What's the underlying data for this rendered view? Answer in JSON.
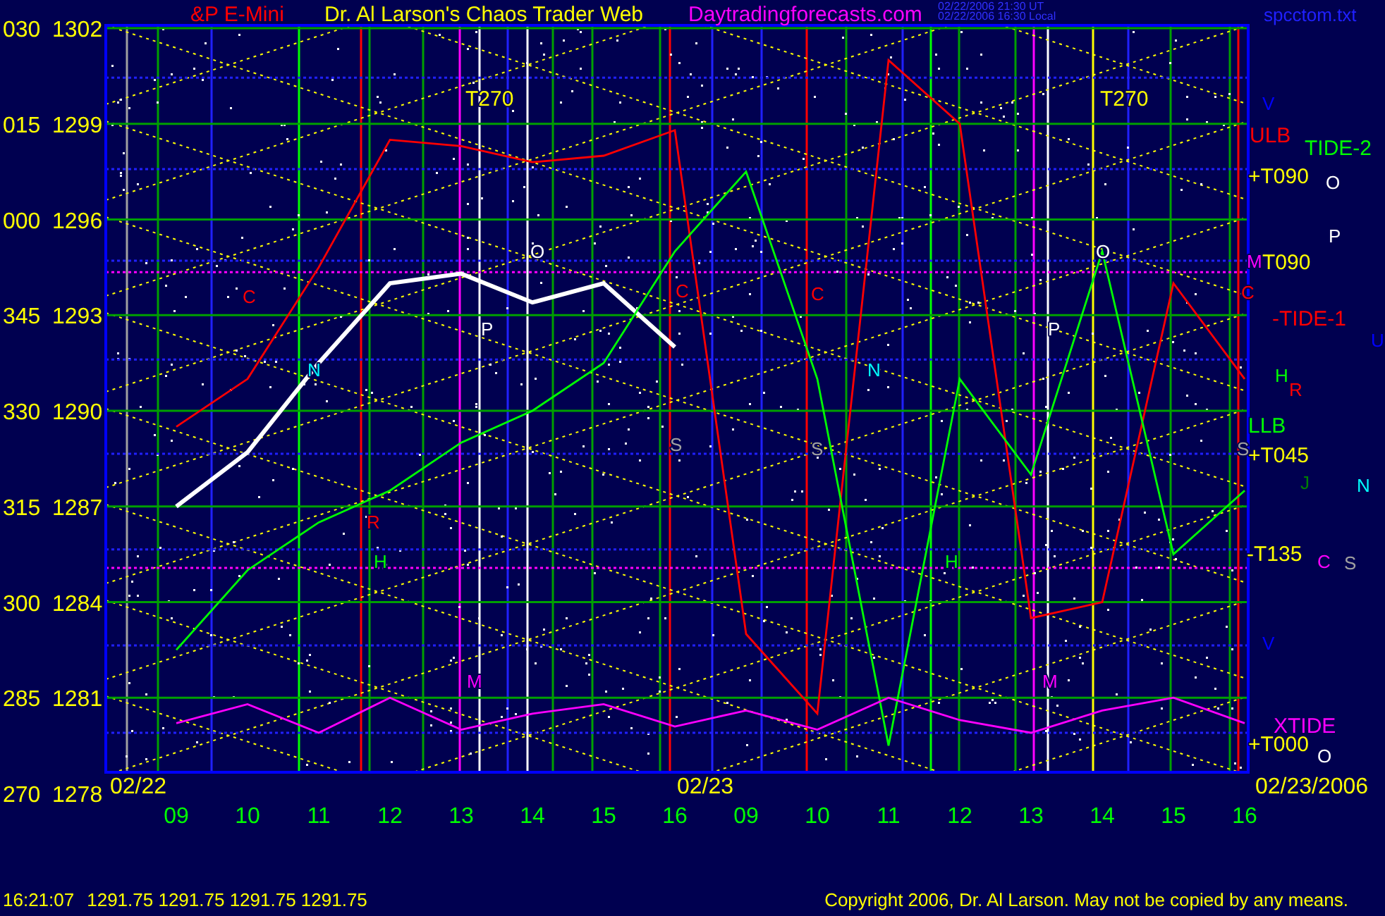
{
  "header": {
    "site_title": "Dr. Al Larson's Chaos Trader Web",
    "website": "Daytradingforecasts.com",
    "timestamps": [
      "02/22/2006 21:30 UT",
      "02/22/2006 16:30 Local"
    ],
    "file_name": "spcctom.txt"
  },
  "chart": {
    "angle_labels": [
      "030",
      "015",
      "000",
      "345",
      "330",
      "315",
      "300",
      "285",
      "270"
    ],
    "chart_data": {
      "type": "line",
      "title": "&P E-Mini",
      "categories": [
        "09",
        "10",
        "11",
        "12",
        "13",
        "14",
        "15",
        "16",
        "09",
        "10",
        "11",
        "12",
        "13",
        "14",
        "15",
        "16"
      ],
      "series": [
        {
          "color": "#ffffff",
          "values": [
            1287,
            1288.7,
            1291.5,
            1294,
            1294.3,
            1293.4,
            1294,
            1292,
            null,
            null,
            null,
            null,
            null,
            null,
            null,
            null
          ]
        },
        {
          "color": "#ff0000",
          "values": [
            1289.5,
            1291,
            1294.5,
            1298.5,
            1298.3,
            1297.8,
            1298,
            1298.8,
            1283,
            1280.5,
            1301,
            1299,
            1283.5,
            1284,
            1294,
            1291
          ]
        },
        {
          "color": "#00ff00",
          "values": [
            1282.5,
            1285,
            1286.5,
            1287.5,
            1289,
            1290,
            1291.5,
            1295,
            1297.5,
            1291,
            1279.5,
            1291,
            1288,
            1295,
            1285.5,
            1287.5
          ]
        },
        {
          "color": "#ff00ff",
          "values": [
            1280.2,
            1280.8,
            1279.9,
            1281,
            1280,
            1280.5,
            1280.8,
            1280.1,
            1280.6,
            1280,
            1281,
            1280.3,
            1279.9,
            1280.6,
            1281,
            1280.2
          ]
        }
      ],
      "ylim": [
        1278,
        1302.09
      ],
      "grid": true,
      "ref_lines": [
        {
          "axis": "y",
          "value": 1300.45,
          "color": "#2020ff"
        },
        {
          "axis": "y",
          "value": 1297.58,
          "color": "#2020ff"
        },
        {
          "axis": "y",
          "value": 1294.71,
          "color": "#2020ff"
        },
        {
          "axis": "y",
          "value": 1291.61,
          "color": "#2020ff"
        },
        {
          "axis": "y",
          "value": 1288.65,
          "color": "#2020ff"
        },
        {
          "axis": "y",
          "value": 1285.65,
          "color": "#2020ff"
        },
        {
          "axis": "y",
          "value": 1282.64,
          "color": "#2020ff"
        },
        {
          "axis": "y",
          "value": 1279.9,
          "color": "#2020ff"
        },
        {
          "axis": "y",
          "value": 1294.35,
          "color": "#ff00ff"
        },
        {
          "axis": "y",
          "value": 1285.07,
          "color": "#ff00ff"
        }
      ],
      "yticks": [
        1302,
        1299,
        1296,
        1293,
        1290,
        1287,
        1284,
        1281,
        1278
      ]
    },
    "markers": [
      {
        "text": "T270",
        "color": "#ffff00"
      },
      {
        "text": "T270",
        "color": "#ffff00"
      },
      {
        "text": "O",
        "color": "#ffffff"
      },
      {
        "text": "O",
        "color": "#ffffff"
      },
      {
        "text": "P",
        "color": "#ffffff"
      },
      {
        "text": "P",
        "color": "#ffffff"
      },
      {
        "text": "N",
        "color": "#00ffff"
      },
      {
        "text": "N",
        "color": "#00ffff"
      },
      {
        "text": "S",
        "color": "#a0a0a0"
      },
      {
        "text": "S",
        "color": "#a0a0a0"
      },
      {
        "text": "R",
        "color": "#ff0000"
      },
      {
        "text": "H",
        "color": "#00ff00"
      },
      {
        "text": "H",
        "color": "#00ff00"
      },
      {
        "text": "M",
        "color": "#ff00ff"
      },
      {
        "text": "M",
        "color": "#ff00ff"
      },
      {
        "text": "C",
        "color": "#ff0000"
      },
      {
        "text": "C",
        "color": "#ff0000"
      },
      {
        "text": "C",
        "color": "#ff0000"
      },
      {
        "text": "ULB",
        "color": "#ff0000"
      },
      {
        "text": "+T090",
        "color": "#ffff00"
      },
      {
        "text": "TIDE-2",
        "color": "#00ff00"
      },
      {
        "text": "O",
        "color": "#ffffff"
      },
      {
        "text": "P",
        "color": "#ffffff"
      },
      {
        "text": "M",
        "color": "#ff00ff"
      },
      {
        "text": "T090",
        "color": "#ffff00"
      },
      {
        "text": "C",
        "color": "#ff0000"
      },
      {
        "text": "-TIDE-1",
        "color": "#ff0000"
      },
      {
        "text": "U",
        "color": "#0000ff"
      },
      {
        "text": "H",
        "color": "#00ff00"
      },
      {
        "text": "R",
        "color": "#ff0000"
      },
      {
        "text": "LLB",
        "color": "#00ff00"
      },
      {
        "text": "S",
        "color": "#a0a0a0"
      },
      {
        "text": "+T045",
        "color": "#ffff00"
      },
      {
        "text": "J",
        "color": "#008000"
      },
      {
        "text": "N",
        "color": "#00ffff"
      },
      {
        "text": "-T135",
        "color": "#ffff00"
      },
      {
        "text": "C",
        "color": "#ff00ff"
      },
      {
        "text": "S",
        "color": "#a0a0a0"
      },
      {
        "text": "V",
        "color": "#0000ff"
      },
      {
        "text": "V",
        "color": "#0000ff"
      },
      {
        "text": "XTIDE",
        "color": "#ff00ff"
      },
      {
        "text": "+T000",
        "color": "#ffff00"
      },
      {
        "text": "O",
        "color": "#ffffff"
      },
      {
        "text": "02/22",
        "color": "#ffff00"
      },
      {
        "text": "02/23",
        "color": "#ffff00"
      },
      {
        "text": "02/23/2006",
        "color": "#ffff00"
      }
    ]
  },
  "status_bar": {
    "time": "16:21:07",
    "prices": "1291.75 1291.75 1291.75 1291.75",
    "copyright": "Copyright 2006, Dr. Al Larson. May not be copied by any means."
  }
}
